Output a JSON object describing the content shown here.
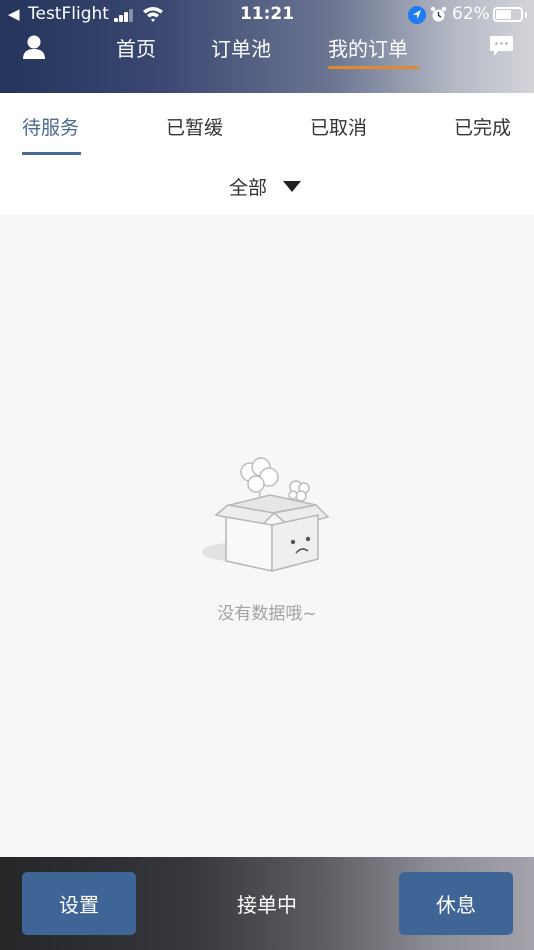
{
  "status_bar": {
    "back_glyph": "◀",
    "app_name": "TestFlight",
    "time": "11:21",
    "battery_percent": "62%",
    "battery_level": 0.62,
    "icons": [
      "signal-icon",
      "wifi-icon",
      "location-icon",
      "alarm-icon",
      "battery-icon"
    ]
  },
  "nav": {
    "user_icon": "user-icon",
    "message_icon": "chat-icon",
    "tabs": [
      {
        "label": "首页"
      },
      {
        "label": "订单池"
      },
      {
        "label": "我的订单"
      }
    ],
    "active_tab": 2,
    "accent_color": "#e08a2d"
  },
  "sub_tabs": {
    "items": [
      {
        "label": "待服务"
      },
      {
        "label": "已暂缓"
      },
      {
        "label": "已取消"
      },
      {
        "label": "已完成"
      }
    ],
    "active": 0,
    "active_color": "#4b6a92"
  },
  "filter": {
    "selected": "全部",
    "caret_icon": "caret-down-icon"
  },
  "empty_state": {
    "icon": "empty-box-icon",
    "message": "没有数据哦~"
  },
  "bottom_bar": {
    "left_button": "设置",
    "status": "接单中",
    "right_button": "休息",
    "button_color": "#3f6597"
  }
}
